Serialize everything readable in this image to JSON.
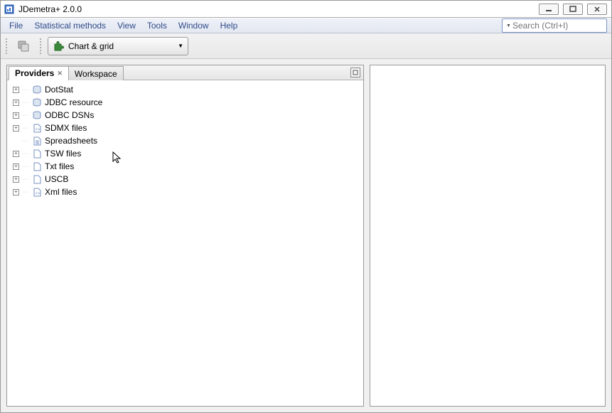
{
  "window": {
    "title": "JDemetra+ 2.0.0"
  },
  "menu": {
    "items": [
      "File",
      "Statistical methods",
      "View",
      "Tools",
      "Window",
      "Help"
    ]
  },
  "search": {
    "placeholder": "Search (Ctrl+I)"
  },
  "toolbar": {
    "chart_dropdown_label": "Chart & grid"
  },
  "tabs": {
    "providers": "Providers",
    "workspace": "Workspace"
  },
  "tree": {
    "items": [
      {
        "label": "DotStat",
        "icon": "db",
        "expandable": true
      },
      {
        "label": "JDBC resource",
        "icon": "db",
        "expandable": true
      },
      {
        "label": "ODBC DSNs",
        "icon": "db",
        "expandable": true
      },
      {
        "label": "SDMX files",
        "icon": "file-code",
        "expandable": true
      },
      {
        "label": "Spreadsheets",
        "icon": "file-sheet",
        "expandable": false
      },
      {
        "label": "TSW files",
        "icon": "file",
        "expandable": true
      },
      {
        "label": "Txt files",
        "icon": "file",
        "expandable": true
      },
      {
        "label": "USCB",
        "icon": "file",
        "expandable": true
      },
      {
        "label": "Xml files",
        "icon": "file-code",
        "expandable": true
      }
    ]
  }
}
